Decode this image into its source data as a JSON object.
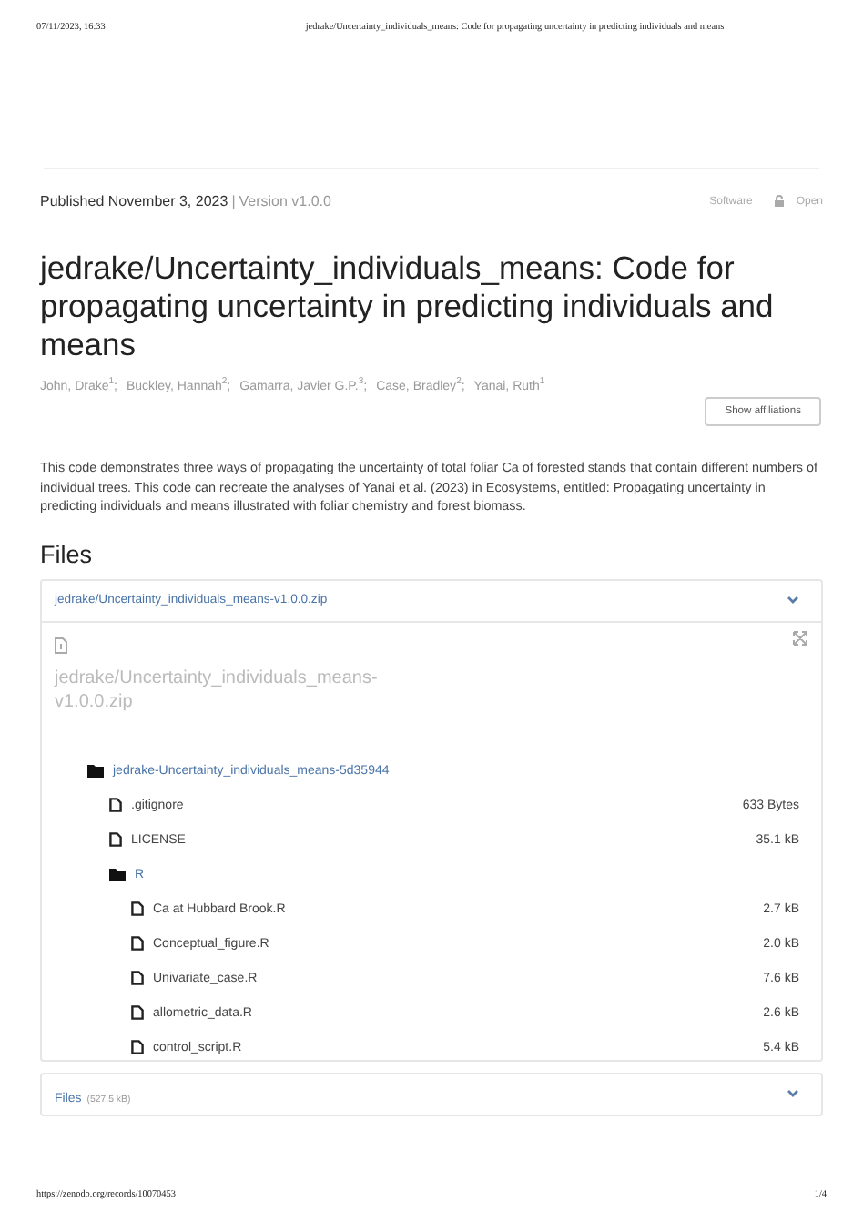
{
  "print_header": {
    "date": "07/11/2023, 16:33",
    "title": "jedrake/Uncertainty_individuals_means: Code for propagating uncertainty in predicting individuals and means"
  },
  "record": {
    "published": "Published November 3, 2023",
    "separator": "|",
    "version": "Version v1.0.0",
    "resource_type": "Software",
    "access": "Open",
    "title": "jedrake/Uncertainty_individuals_means: Code for propagating uncertainty in predicting individuals and means",
    "creators": [
      "John, Drake$^{1}$;",
      "Buckley, Hannah$^{2}$;",
      "Gamarra, Javier G.P.$^{3}$;",
      "Case, Bradley$^{2}$;",
      "Yanai, Ruth$^{1}$"
    ],
    "affiliations_button": "Show affiliations",
    "description": "This code demonstrates three ways of propagating the uncertainty of total foliar Ca of forested stands that contain different numbers of individual trees. This code can recreate the analyses of Yanai et al. (2023) in Ecosystems, entitled: Propagating uncertainty in predicting individuals and means illustrated with foliar chemistry and forest biomass."
  },
  "files": {
    "heading": "Files",
    "archive": {
      "name": "jedrake/Uncertainty_individuals_means-v1.0.0.zip",
      "preview_title": "jedrake/Uncertainty_individuals_means-v1.0.0.zip",
      "tree": [
        {
          "kind": "folder",
          "name": "jedrake-Uncertainty_individuals_means-5d35944",
          "children": [
            {
              "kind": "file",
              "name": ".gitignore",
              "size": "633 Bytes"
            },
            {
              "kind": "file",
              "name": "LICENSE",
              "size": "35.1 kB"
            },
            {
              "kind": "folder",
              "name": "R",
              "children": [
                {
                  "kind": "file",
                  "name": "Ca at Hubbard Brook.R",
                  "size": "2.7 kB"
                },
                {
                  "kind": "file",
                  "name": "Conceptual_figure.R",
                  "size": "2.0 kB"
                },
                {
                  "kind": "file",
                  "name": "Univariate_case.R",
                  "size": "7.6 kB"
                },
                {
                  "kind": "file",
                  "name": "allometric_data.R",
                  "size": "2.6 kB"
                },
                {
                  "kind": "file",
                  "name": "control_script.R",
                  "size": "5.4 kB"
                }
              ]
            }
          ]
        }
      ]
    },
    "total_label": "Files",
    "total_size": "(527.5 kB)"
  },
  "print_footer": {
    "url": "https://zenodo.org/records/10070453",
    "page": "1/4"
  }
}
